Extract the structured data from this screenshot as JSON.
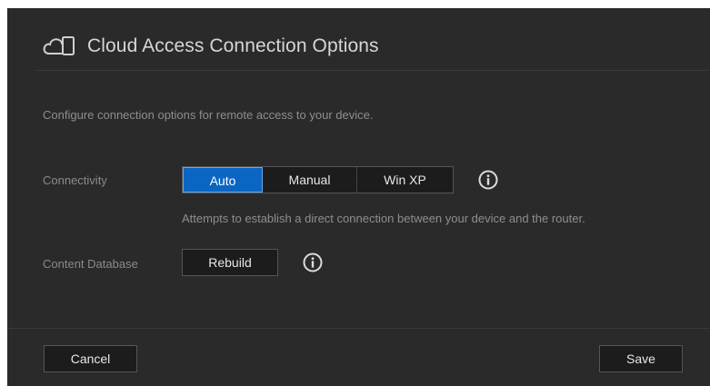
{
  "dialog": {
    "title": "Cloud Access Connection Options",
    "title_icon": "cloud-device-icon",
    "intro": "Configure connection options for remote access to your device."
  },
  "connectivity": {
    "label": "Connectivity",
    "options": [
      "Auto",
      "Manual",
      "Win XP"
    ],
    "selected": "Auto",
    "hint": "Attempts to establish a direct connection between your device and the router.",
    "info_icon": "info-icon"
  },
  "content_database": {
    "label": "Content Database",
    "button_label": "Rebuild",
    "info_icon": "info-icon"
  },
  "footer": {
    "cancel_label": "Cancel",
    "save_label": "Save"
  },
  "colors": {
    "background": "#2a2a2a",
    "accent": "#0b66c3",
    "text": "#e6e6e6",
    "muted_text": "#8e8e8e"
  }
}
